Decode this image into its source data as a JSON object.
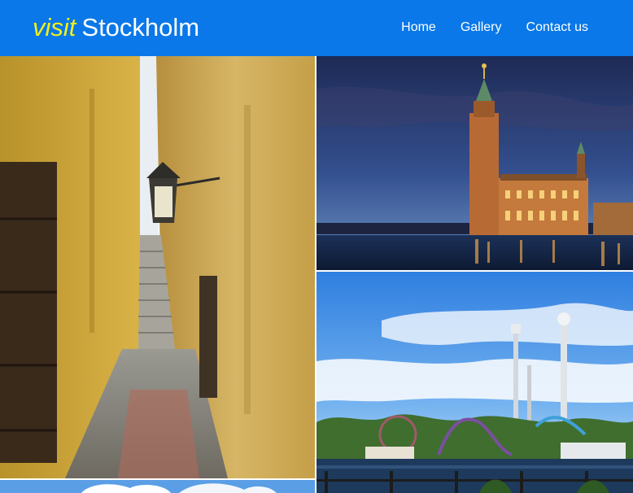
{
  "header": {
    "logo_prefix": "visit",
    "logo_name": "Stockholm",
    "colors": {
      "background": "#0a78e8",
      "accent": "#f2f01a",
      "text": "#ffffff"
    }
  },
  "nav": {
    "items": [
      {
        "label": "Home"
      },
      {
        "label": "Gallery"
      },
      {
        "label": "Contact us"
      }
    ]
  },
  "gallery": {
    "photos": [
      {
        "subject": "narrow-alley-with-street-lamp"
      },
      {
        "subject": "city-hall-at-dusk"
      },
      {
        "subject": "amusement-park-by-water"
      },
      {
        "subject": "sky-with-clouds-partial"
      }
    ]
  }
}
